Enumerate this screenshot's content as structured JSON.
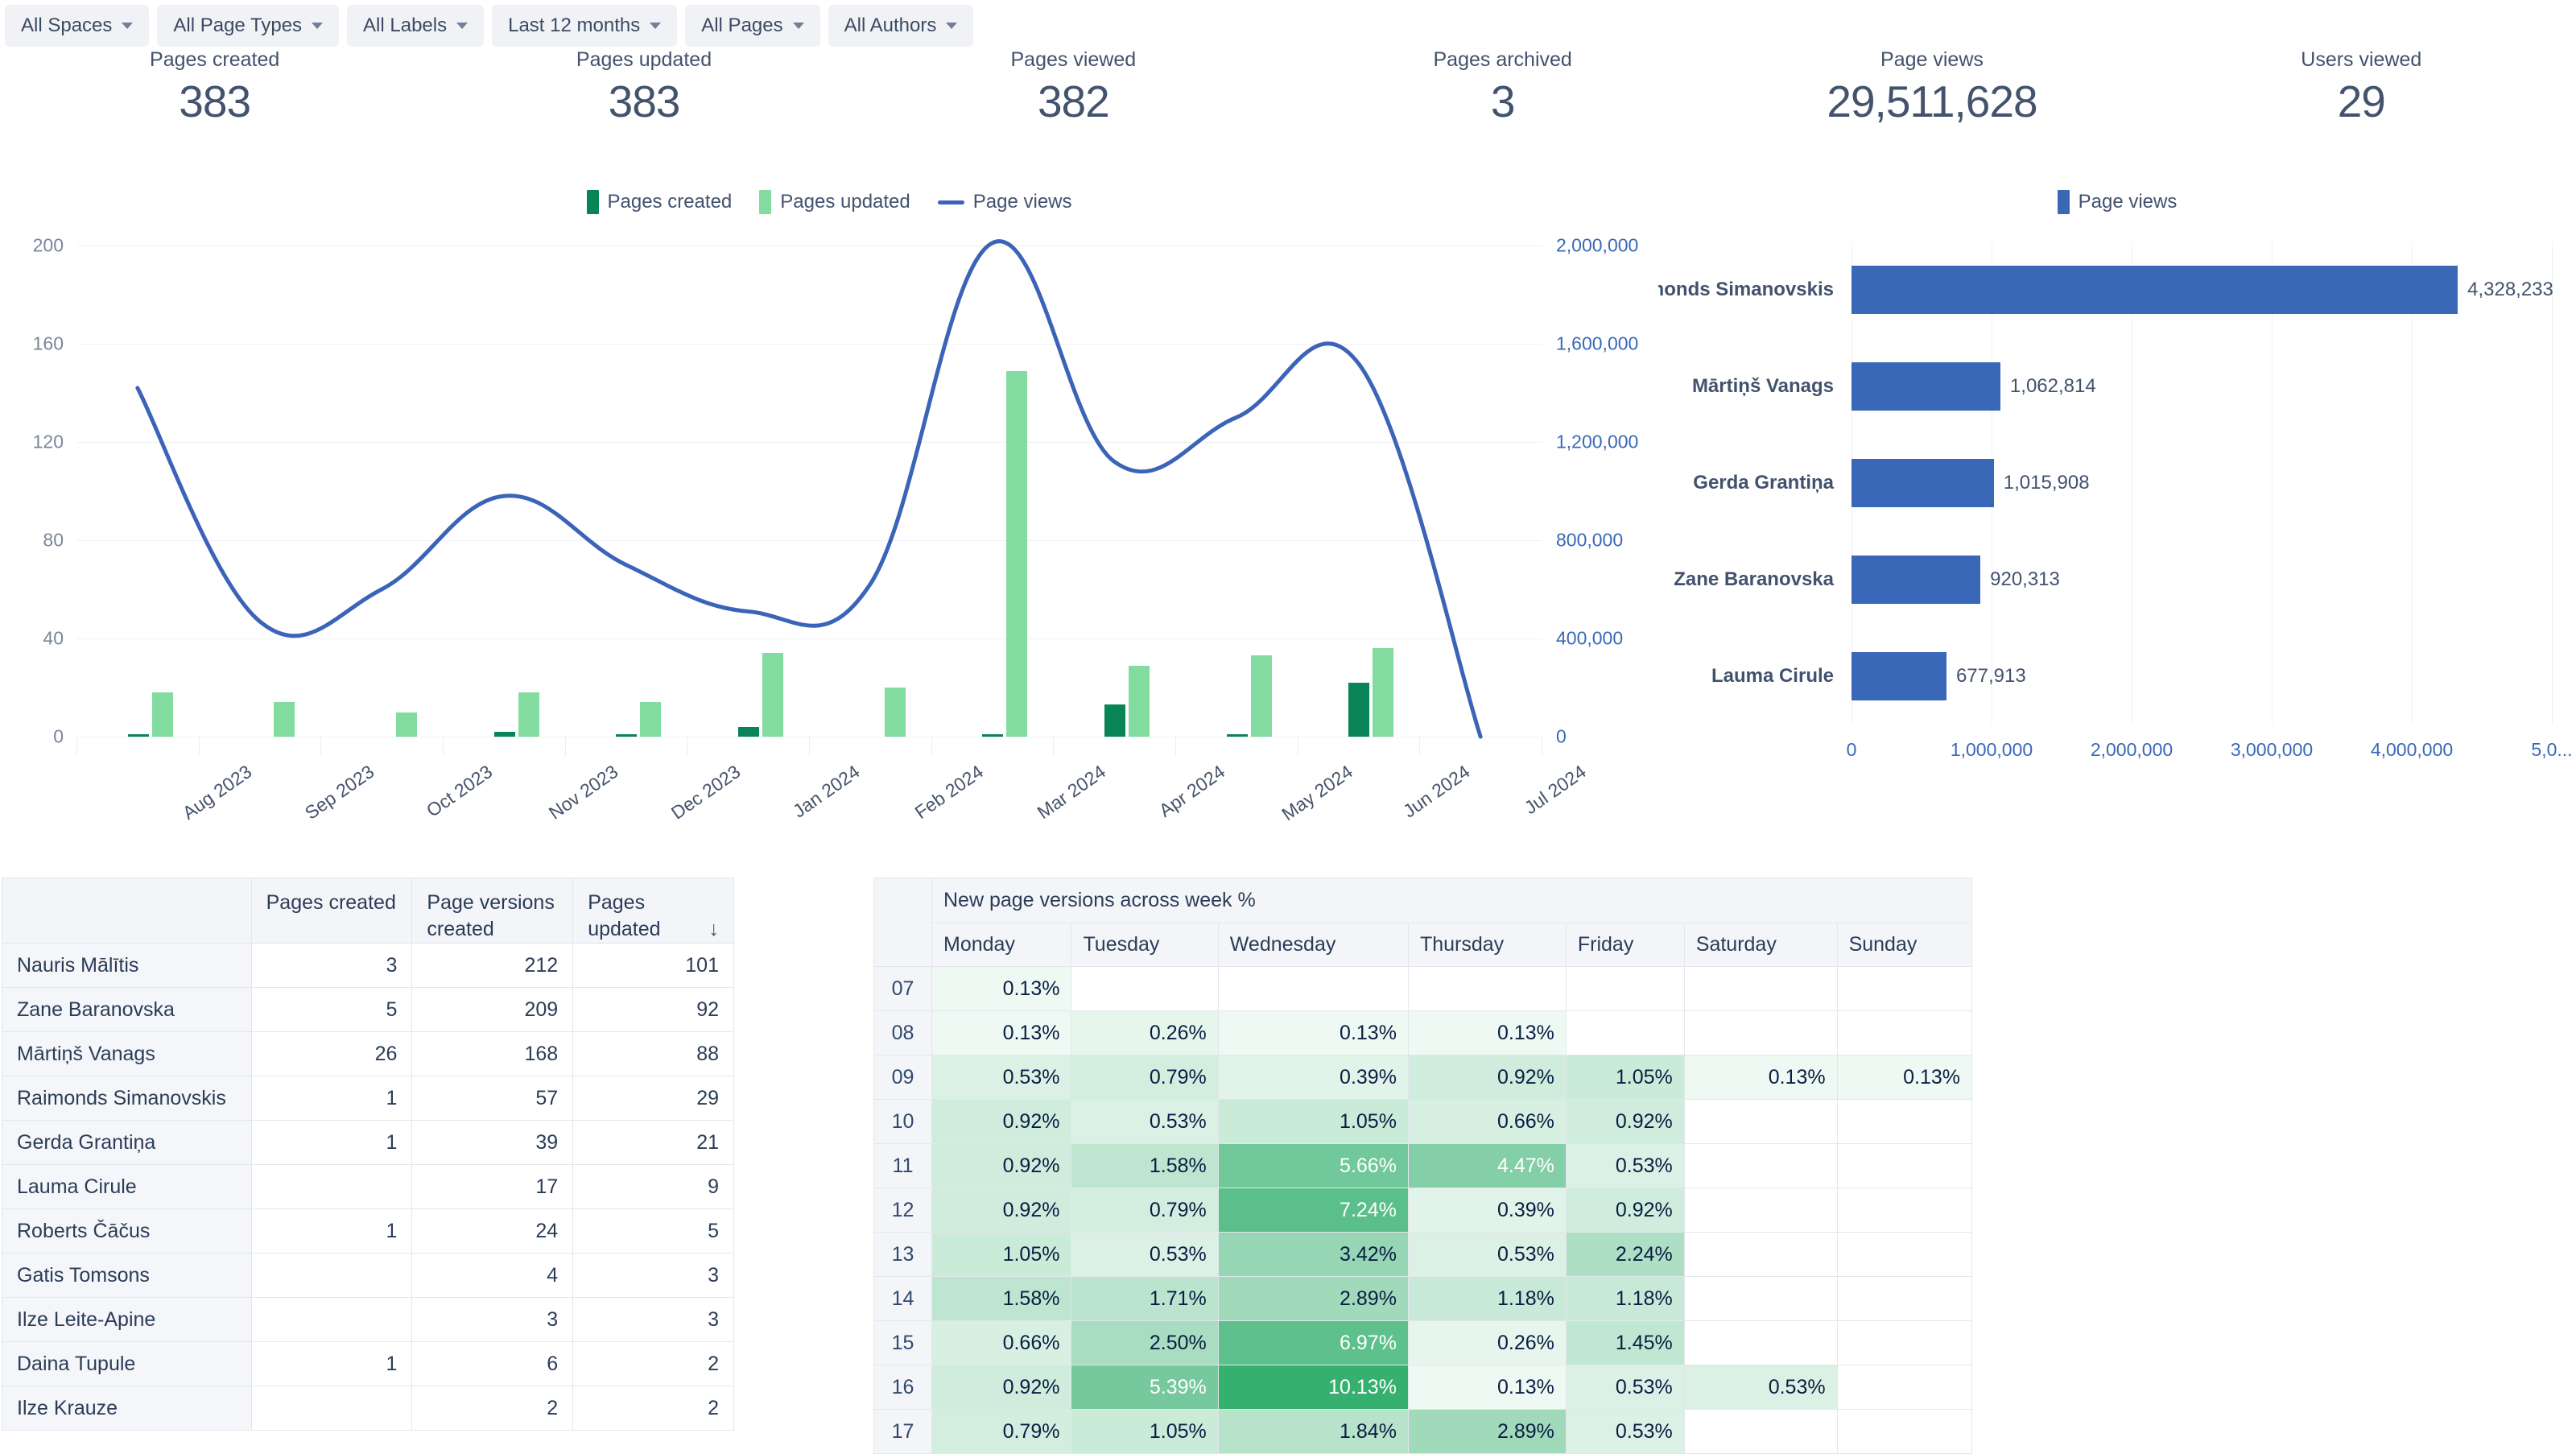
{
  "filters": [
    {
      "label": "All Spaces",
      "name": "filter-all-spaces"
    },
    {
      "label": "All Page Types",
      "name": "filter-all-page-types"
    },
    {
      "label": "All Labels",
      "name": "filter-all-labels"
    },
    {
      "label": "Last 12 months",
      "name": "filter-last-12-months"
    },
    {
      "label": "All Pages",
      "name": "filter-all-pages"
    },
    {
      "label": "All Authors",
      "name": "filter-all-authors"
    }
  ],
  "kpis": [
    {
      "label": "Pages created",
      "value": "383"
    },
    {
      "label": "Pages updated",
      "value": "383"
    },
    {
      "label": "Pages viewed",
      "value": "382"
    },
    {
      "label": "Pages archived",
      "value": "3"
    },
    {
      "label": "Page views",
      "value": "29,511,628"
    },
    {
      "label": "Users viewed",
      "value": "29"
    }
  ],
  "colors": {
    "pages_created": "#088457",
    "pages_updated": "#82dca0",
    "page_views_line": "#3b63b8",
    "page_views_bar": "#3a68b8",
    "heat_max": "#35b06f",
    "text": "#42526e"
  },
  "chart_data": [
    {
      "type": "bar",
      "id": "combo-chart",
      "title": "",
      "categories": [
        "Aug 2023",
        "Sep 2023",
        "Oct 2023",
        "Nov 2023",
        "Dec 2023",
        "Jan 2024",
        "Feb 2024",
        "Mar 2024",
        "Apr 2024",
        "May 2024",
        "Jun 2024",
        "Jul 2024"
      ],
      "series": [
        {
          "name": "Pages created",
          "type": "bar",
          "color": "#088457",
          "values": [
            1,
            0,
            0,
            2,
            1,
            4,
            0,
            1,
            13,
            1,
            22,
            0
          ]
        },
        {
          "name": "Pages updated",
          "type": "bar",
          "color": "#82dca0",
          "values": [
            18,
            14,
            10,
            18,
            14,
            34,
            20,
            149,
            29,
            33,
            36,
            0
          ]
        },
        {
          "name": "Page views",
          "type": "line",
          "color": "#3b63b8",
          "axis": "right",
          "values": [
            1420000,
            470000,
            600000,
            980000,
            700000,
            510000,
            620000,
            2010000,
            1120000,
            1300000,
            1520000,
            0
          ]
        }
      ],
      "xlabel": "",
      "ylabel_left": "",
      "ylabel_right": "",
      "ylim_left": [
        0,
        200
      ],
      "ylim_right": [
        0,
        2000000
      ],
      "yticks_left": [
        "0",
        "40",
        "80",
        "120",
        "160",
        "200"
      ],
      "yticks_right": [
        "0",
        "400,000",
        "800,000",
        "1,200,000",
        "1,600,000",
        "2,000,000"
      ],
      "grid": true,
      "legend_position": "top-center"
    },
    {
      "type": "bar",
      "id": "top-authors-chart",
      "orientation": "horizontal",
      "title": "",
      "legend": [
        "Page views"
      ],
      "legend_position": "top-center",
      "categories": [
        "Raimonds Simanovskis",
        "Mārtiņš Vanags",
        "Gerda Grantiņa",
        "Zane Baranovska",
        "Lauma Cirule"
      ],
      "values": [
        4328233,
        1062814,
        1015908,
        920313,
        677913
      ],
      "value_labels": [
        "4,328,233",
        "1,062,814",
        "1,015,908",
        "920,313",
        "677,913"
      ],
      "xticks": [
        "0",
        "1,000,000",
        "2,000,000",
        "3,000,000",
        "4,000,000",
        "5,0..."
      ],
      "xlim": [
        0,
        5000000
      ],
      "grid": true
    }
  ],
  "left_table": {
    "columns": [
      "",
      "Pages created",
      "Page versions created",
      "Pages updated"
    ],
    "sorted_column": "Pages updated",
    "sort_indicator": "↓",
    "rows": [
      {
        "name": "Nauris Mālītis",
        "created": "3",
        "versions": "212",
        "updated": "101"
      },
      {
        "name": "Zane Baranovska",
        "created": "5",
        "versions": "209",
        "updated": "92"
      },
      {
        "name": "Mārtiņš Vanags",
        "created": "26",
        "versions": "168",
        "updated": "88"
      },
      {
        "name": "Raimonds Simanovskis",
        "created": "1",
        "versions": "57",
        "updated": "29"
      },
      {
        "name": "Gerda Grantiņa",
        "created": "1",
        "versions": "39",
        "updated": "21"
      },
      {
        "name": "Lauma Cirule",
        "created": "",
        "versions": "17",
        "updated": "9"
      },
      {
        "name": "Roberts Čāčus",
        "created": "1",
        "versions": "24",
        "updated": "5"
      },
      {
        "name": "Gatis Tomsons",
        "created": "",
        "versions": "4",
        "updated": "3"
      },
      {
        "name": "Ilze Leite-Apine",
        "created": "",
        "versions": "3",
        "updated": "3"
      },
      {
        "name": "Daina Tupule",
        "created": "1",
        "versions": "6",
        "updated": "2"
      },
      {
        "name": "Ilze Krauze",
        "created": "",
        "versions": "2",
        "updated": "2"
      }
    ]
  },
  "heat_table": {
    "group_header": "New page versions across week %",
    "days": [
      "Monday",
      "Tuesday",
      "Wednesday",
      "Thursday",
      "Friday",
      "Saturday",
      "Sunday"
    ],
    "rows": [
      {
        "hour": "07",
        "values": [
          "0.13%",
          "",
          "",
          "",
          "",
          "",
          ""
        ]
      },
      {
        "hour": "08",
        "values": [
          "0.13%",
          "0.26%",
          "0.13%",
          "0.13%",
          "",
          "",
          ""
        ]
      },
      {
        "hour": "09",
        "values": [
          "0.53%",
          "0.79%",
          "0.39%",
          "0.92%",
          "1.05%",
          "0.13%",
          "0.13%"
        ]
      },
      {
        "hour": "10",
        "values": [
          "0.92%",
          "0.53%",
          "1.05%",
          "0.66%",
          "0.92%",
          "",
          ""
        ]
      },
      {
        "hour": "11",
        "values": [
          "0.92%",
          "1.58%",
          "5.66%",
          "4.47%",
          "0.53%",
          "",
          ""
        ]
      },
      {
        "hour": "12",
        "values": [
          "0.92%",
          "0.79%",
          "7.24%",
          "0.39%",
          "0.92%",
          "",
          ""
        ]
      },
      {
        "hour": "13",
        "values": [
          "1.05%",
          "0.53%",
          "3.42%",
          "0.53%",
          "2.24%",
          "",
          ""
        ]
      },
      {
        "hour": "14",
        "values": [
          "1.58%",
          "1.71%",
          "2.89%",
          "1.18%",
          "1.18%",
          "",
          ""
        ]
      },
      {
        "hour": "15",
        "values": [
          "0.66%",
          "2.50%",
          "6.97%",
          "0.26%",
          "1.45%",
          "",
          ""
        ]
      },
      {
        "hour": "16",
        "values": [
          "0.92%",
          "5.39%",
          "10.13%",
          "0.13%",
          "0.53%",
          "0.53%",
          ""
        ]
      },
      {
        "hour": "17",
        "values": [
          "0.79%",
          "1.05%",
          "1.84%",
          "2.89%",
          "0.53%",
          "",
          ""
        ]
      }
    ]
  }
}
